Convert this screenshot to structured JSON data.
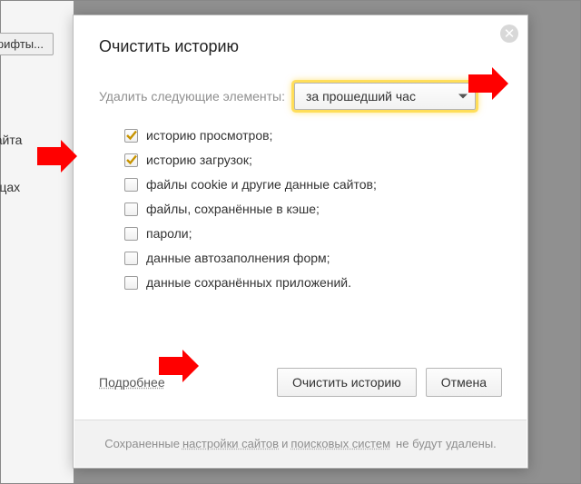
{
  "background": {
    "fonts_btn": "Шрифты...",
    "link1": "и сайта",
    "link2": "аницах"
  },
  "dialog": {
    "title": "Очистить историю",
    "close_label": "✕",
    "period_label": "Удалить следующие элементы:",
    "period_value": "за прошедший час",
    "options": [
      {
        "label": "историю просмотров;",
        "checked": true
      },
      {
        "label": "историю загрузок;",
        "checked": true
      },
      {
        "label": "файлы cookie и другие данные сайтов;",
        "checked": false
      },
      {
        "label": "файлы, сохранённые в кэше;",
        "checked": false
      },
      {
        "label": "пароли;",
        "checked": false
      },
      {
        "label": "данные автозаполнения форм;",
        "checked": false
      },
      {
        "label": "данные сохранённых приложений.",
        "checked": false
      }
    ],
    "details": "Подробнее",
    "primary_btn": "Очистить историю",
    "cancel_btn": "Отмена",
    "footer": {
      "t1": "Сохраненные",
      "link1": "настройки сайтов",
      "t2": "и",
      "link2": "поисковых систем",
      "t3": "не будут удалены."
    }
  }
}
